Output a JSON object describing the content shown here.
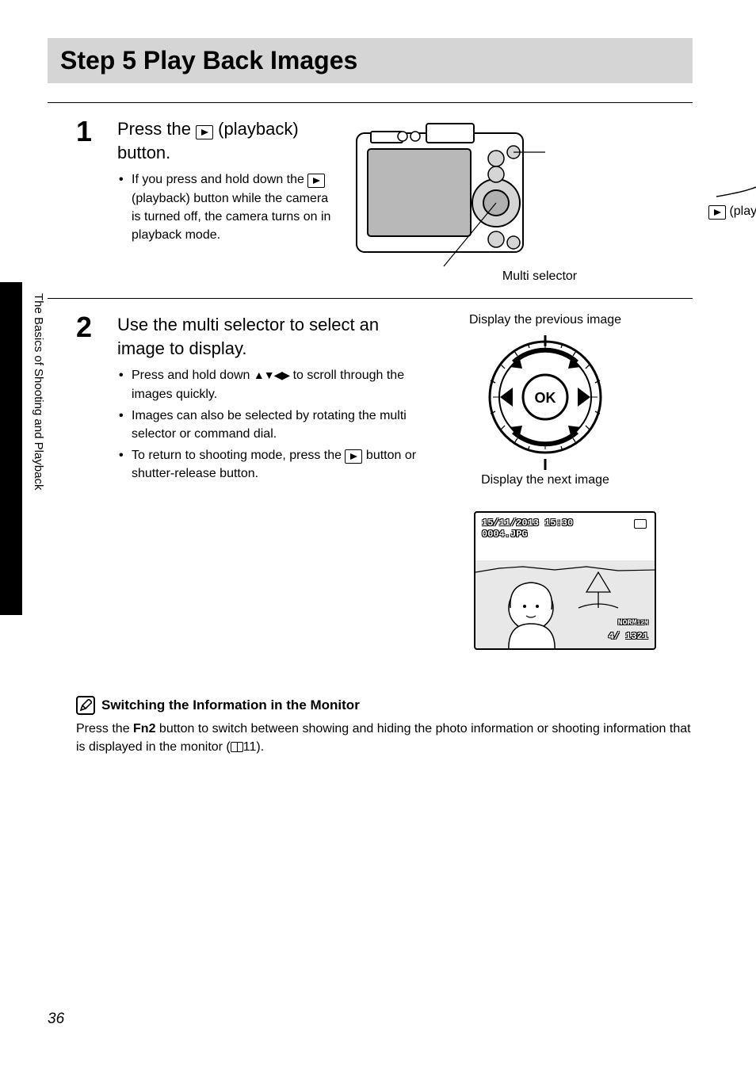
{
  "section": {
    "title": "Step 5 Play Back Images"
  },
  "side_label": "The Basics of Shooting and Playback",
  "step1": {
    "number": "1",
    "heading_before": "Press the ",
    "heading_after": " (playback) button.",
    "bullets": [
      "If you press and hold down the▕ (playback) button while the camera is turned off, the camera turns on in playback mode."
    ],
    "annotation_multi_selector": "Multi selector",
    "annotation_playback_button": " (playback) button"
  },
  "step2": {
    "number": "2",
    "heading": "Use the multi selector to select an image to display.",
    "bullets": [
      "Press and hold down ▲▼◀▶ to scroll through the images quickly.",
      "Images can also be selected by rotating the multi selector or command dial.",
      "To return to shooting mode, press the ▶ button or shutter-release button."
    ],
    "prev_label": "Display the previous image",
    "next_label": "Display the next image",
    "screen": {
      "datetime": "15/11/2013 15:30",
      "file": "0004.JPG",
      "norm": "NORM",
      "counter": "4/ 1321"
    }
  },
  "note": {
    "title": "Switching the Information in the Monitor",
    "body_before": "Press the ",
    "fn_label": "Fn2",
    "body_mid": " button to switch between showing and hiding the photo information or shooting information that is displayed in the monitor (",
    "page_ref": "11).",
    "body_after": ""
  },
  "page_number": "36"
}
